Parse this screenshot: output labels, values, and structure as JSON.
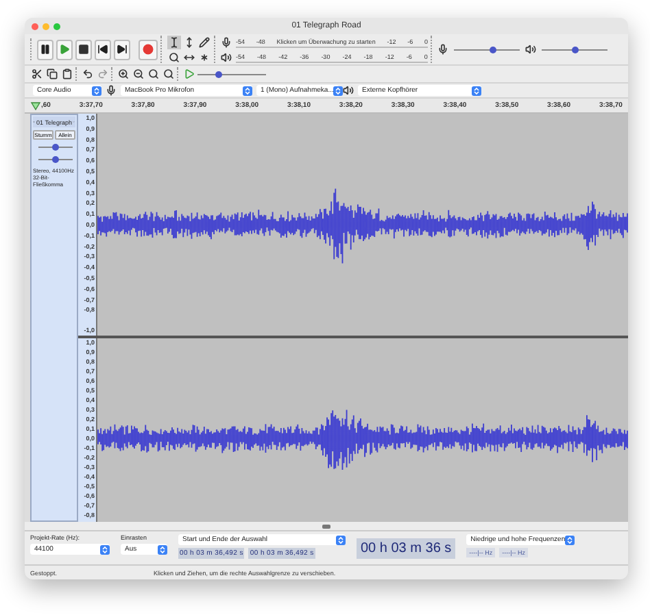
{
  "window": {
    "title": "01 Telegraph Road"
  },
  "meters": {
    "record": {
      "ticks": [
        "-54",
        "-48",
        "-12",
        "-6",
        "0"
      ],
      "hint": "Klicken um Überwachung zu starten"
    },
    "playback": {
      "ticks": [
        "-54",
        "-48",
        "-42",
        "-36",
        "-30",
        "-24",
        "-18",
        "-12",
        "-6",
        "0"
      ]
    }
  },
  "mixer": {
    "record_volume": {
      "level": 0.6
    },
    "playback_volume": {
      "level": 0.5
    }
  },
  "play_at_speed": {
    "level": 0.3
  },
  "devices": {
    "host": "Core Audio",
    "input": "MacBook Pro Mikrofon",
    "channels": "1 (Mono) Aufnahmeka...",
    "output": "Externe Kopfhörer"
  },
  "ruler": {
    "ticks": [
      ",60",
      "3:37,70",
      "3:37,80",
      "3:37,90",
      "3:38,00",
      "3:38,10",
      "3:38,20",
      "3:38,30",
      "3:38,40",
      "3:38,50",
      "3:38,60",
      "3:38,70"
    ]
  },
  "track": {
    "name": "01 Telegraph",
    "mute": "Stumm",
    "solo": "Allein",
    "gain": {
      "level": 0.5
    },
    "pan": {
      "level": 0.5
    },
    "info": [
      "Stereo, 44100Hz",
      "32-Bit-Fließkomma"
    ],
    "channels": [
      {
        "ticks": [
          "1,0",
          "0,9",
          "0,8",
          "0,7",
          "0,6",
          "0,5",
          "0,4",
          "0,3",
          "0,2",
          "0,1",
          "0,0",
          "-0,1",
          "-0,2",
          "-0,3",
          "-0,4",
          "-0,5",
          "-0,6",
          "-0,7",
          "-0,8"
        ],
        "end": "-1,0"
      },
      {
        "ticks": [
          "1,0",
          "0,9",
          "0,8",
          "0,7",
          "0,6",
          "0,5",
          "0,4",
          "0,3",
          "0,2",
          "0,1",
          "0,0",
          "-0,1",
          "-0,2",
          "-0,3",
          "-0,4",
          "-0,5",
          "-0,6",
          "-0,7",
          "-0,8"
        ]
      }
    ]
  },
  "selection_bar": {
    "rate_label": "Projekt-Rate (Hz):",
    "rate": "44100",
    "snap_label": "Einrasten",
    "snap": "Aus",
    "mode": "Start und Ende der Auswahl",
    "start": "00 h 03 m 36,492 s",
    "end": "00 h 03 m 36,492 s",
    "position": "00 h 03 m 36 s",
    "spectral_mode": "Niedrige und hohe Frequenzen",
    "low_freq": "----|-- Hz",
    "high_freq": "----|-- Hz"
  },
  "status_bar": {
    "state": "Gestoppt.",
    "hint": "Klicken und Ziehen, um die rechte Auswahlgrenze zu verschieben."
  }
}
